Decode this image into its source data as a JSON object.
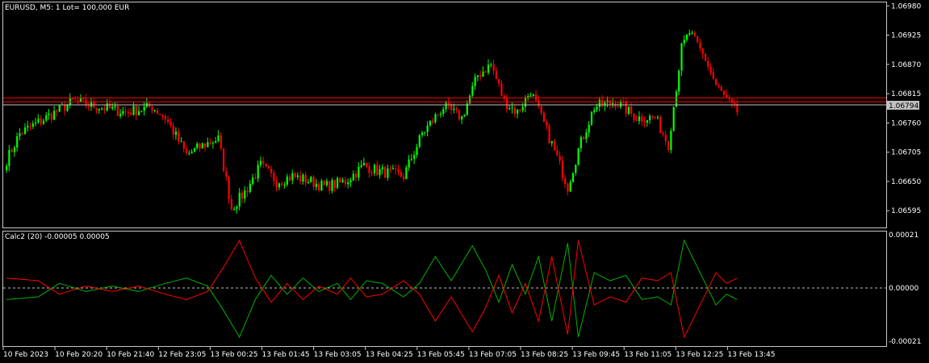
{
  "main": {
    "label": "EURUSD, M5:  1 Lot= 100,000 EUR",
    "price_ticks": [
      "1.06980",
      "1.06925",
      "1.06870",
      "1.06815",
      "1.06760",
      "1.06705",
      "1.06650",
      "1.06595"
    ],
    "current_price": "1.06794"
  },
  "indicator": {
    "label": "Calc2 (20) -0.00005 0.00005",
    "ticks": [
      "0.00021",
      "0.00000",
      "-0.00021"
    ]
  },
  "time_ticks": [
    "10 Feb 2023",
    "10 Feb 20:20",
    "10 Feb 21:40",
    "12 Feb 23:05",
    "13 Feb 00:25",
    "13 Feb 01:45",
    "13 Feb 03:05",
    "13 Feb 04:25",
    "13 Feb 05:45",
    "13 Feb 07:05",
    "13 Feb 08:25",
    "13 Feb 09:45",
    "13 Feb 11:05",
    "13 Feb 12:25",
    "13 Feb 13:45"
  ],
  "colors": {
    "background": "#000000",
    "frame": "#c8c8c8",
    "bull_candle": "#00ff00",
    "bear_candle": "#ff0000",
    "level_line": "#ff0000",
    "bid_line": "#c0c0c0",
    "osc_green": "#00b400",
    "osc_red": "#ff0000"
  },
  "chart_data": [
    {
      "type": "candlestick",
      "title": "EURUSD, M5",
      "ylim": [
        1.06565,
        1.06985
      ],
      "levels": [
        1.06805
      ],
      "last_price": 1.06794,
      "anchors": [
        [
          0,
          1.0669
        ],
        [
          5,
          1.0674
        ],
        [
          15,
          1.0677
        ],
        [
          25,
          1.068
        ],
        [
          35,
          1.0679
        ],
        [
          45,
          1.0678
        ],
        [
          55,
          1.0679
        ],
        [
          60,
          1.0677
        ],
        [
          68,
          1.067
        ],
        [
          75,
          1.0672
        ],
        [
          80,
          1.0673
        ],
        [
          85,
          1.066
        ],
        [
          90,
          1.0663
        ],
        [
          96,
          1.0668
        ],
        [
          102,
          1.0665
        ],
        [
          108,
          1.0666
        ],
        [
          115,
          1.0665
        ],
        [
          120,
          1.0664
        ],
        [
          128,
          1.0665
        ],
        [
          135,
          1.0668
        ],
        [
          140,
          1.0667
        ],
        [
          150,
          1.0666
        ],
        [
          157,
          1.0674
        ],
        [
          165,
          1.0679
        ],
        [
          172,
          1.0677
        ],
        [
          178,
          1.0685
        ],
        [
          183,
          1.0687
        ],
        [
          188,
          1.068
        ],
        [
          193,
          1.0678
        ],
        [
          198,
          1.0682
        ],
        [
          202,
          1.0677
        ],
        [
          206,
          1.0672
        ],
        [
          212,
          1.0664
        ],
        [
          216,
          1.0671
        ],
        [
          222,
          1.0679
        ],
        [
          230,
          1.068
        ],
        [
          238,
          1.0677
        ],
        [
          245,
          1.0677
        ],
        [
          250,
          1.0672
        ],
        [
          255,
          1.069
        ],
        [
          258,
          1.0693
        ],
        [
          264,
          1.0688
        ],
        [
          268,
          1.0683
        ],
        [
          274,
          1.0679
        ],
        [
          276,
          1.0678
        ]
      ]
    },
    {
      "type": "line",
      "title": "Calc2 (20)",
      "ylim": [
        -0.00021,
        0.00021
      ],
      "series": [
        {
          "color": "green",
          "anchors": [
            [
              0,
              -4e-05
            ],
            [
              12,
              -3e-05
            ],
            [
              20,
              2e-05
            ],
            [
              30,
              -1e-05
            ],
            [
              40,
              1e-05
            ],
            [
              50,
              -1e-05
            ],
            [
              60,
              2e-05
            ],
            [
              68,
              4e-05
            ],
            [
              76,
              1e-05
            ],
            [
              82,
              -8e-05
            ],
            [
              88,
              -0.00018
            ],
            [
              94,
              -4e-05
            ],
            [
              100,
              5e-05
            ],
            [
              106,
              -2e-05
            ],
            [
              112,
              4e-05
            ],
            [
              118,
              -1e-05
            ],
            [
              125,
              2e-05
            ],
            [
              130,
              -4e-05
            ],
            [
              136,
              3e-05
            ],
            [
              142,
              2e-05
            ],
            [
              150,
              -3e-05
            ],
            [
              156,
              2e-05
            ],
            [
              162,
              0.00012
            ],
            [
              168,
              3e-05
            ],
            [
              176,
              0.00016
            ],
            [
              181,
              7e-05
            ],
            [
              186,
              -5e-05
            ],
            [
              191,
              9e-05
            ],
            [
              196,
              -2e-05
            ],
            [
              201,
              0.00012
            ],
            [
              206,
              -0.00012
            ],
            [
              212,
              0.00017
            ],
            [
              216,
              -0.00018
            ],
            [
              222,
              6e-05
            ],
            [
              228,
              3e-05
            ],
            [
              234,
              5e-05
            ],
            [
              240,
              -4e-05
            ],
            [
              246,
              -3e-05
            ],
            [
              251,
              -6e-05
            ],
            [
              256,
              0.00018
            ],
            [
              260,
              0.0001
            ],
            [
              264,
              2e-05
            ],
            [
              268,
              -6e-05
            ],
            [
              272,
              -2e-05
            ],
            [
              276,
              -4e-05
            ]
          ]
        },
        {
          "color": "red",
          "anchors": [
            [
              0,
              4e-05
            ],
            [
              12,
              3e-05
            ],
            [
              20,
              -2e-05
            ],
            [
              30,
              1e-05
            ],
            [
              40,
              -1e-05
            ],
            [
              50,
              1e-05
            ],
            [
              60,
              -2e-05
            ],
            [
              68,
              -4e-05
            ],
            [
              76,
              -1e-05
            ],
            [
              82,
              8e-05
            ],
            [
              88,
              0.00018
            ],
            [
              94,
              4e-05
            ],
            [
              100,
              -5e-05
            ],
            [
              106,
              2e-05
            ],
            [
              112,
              -4e-05
            ],
            [
              118,
              1e-05
            ],
            [
              125,
              -2e-05
            ],
            [
              130,
              4e-05
            ],
            [
              136,
              -3e-05
            ],
            [
              142,
              -2e-05
            ],
            [
              150,
              3e-05
            ],
            [
              156,
              -2e-05
            ],
            [
              162,
              -0.00012
            ],
            [
              168,
              -3e-05
            ],
            [
              176,
              -0.00016
            ],
            [
              181,
              -7e-05
            ],
            [
              186,
              5e-05
            ],
            [
              191,
              -9e-05
            ],
            [
              196,
              2e-05
            ],
            [
              201,
              -0.00012
            ],
            [
              206,
              0.00012
            ],
            [
              212,
              -0.00017
            ],
            [
              216,
              0.00018
            ],
            [
              222,
              -6e-05
            ],
            [
              228,
              -3e-05
            ],
            [
              234,
              -5e-05
            ],
            [
              240,
              4e-05
            ],
            [
              246,
              3e-05
            ],
            [
              251,
              6e-05
            ],
            [
              256,
              -0.00018
            ],
            [
              260,
              -0.0001
            ],
            [
              264,
              -2e-05
            ],
            [
              268,
              6e-05
            ],
            [
              272,
              2e-05
            ],
            [
              276,
              4e-05
            ]
          ]
        }
      ]
    }
  ]
}
